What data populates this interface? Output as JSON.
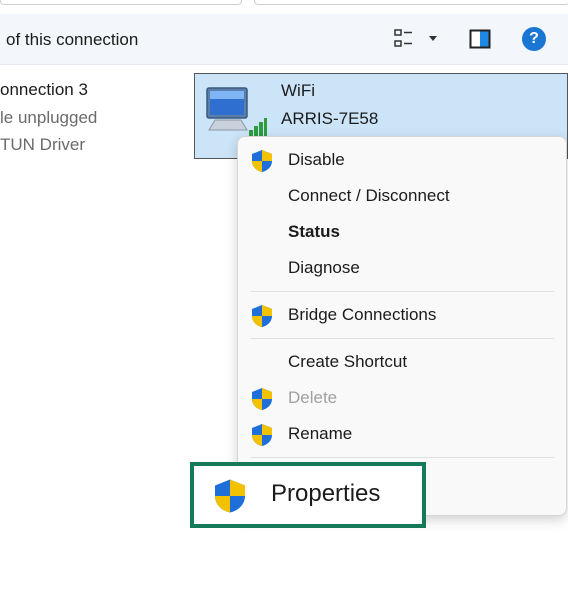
{
  "command_bar": {
    "description_text": "of this connection"
  },
  "left_adapter": {
    "name": "onnection 3",
    "status": "le unplugged",
    "driver": "TUN Driver"
  },
  "wifi_adapter": {
    "name": "WiFi",
    "ssid": "ARRIS-7E58"
  },
  "context_menu": {
    "items": [
      {
        "label": "Disable"
      },
      {
        "label": "Connect / Disconnect"
      },
      {
        "label": "Status"
      },
      {
        "label": "Diagnose"
      },
      {
        "label": "Bridge Connections"
      },
      {
        "label": "Create Shortcut"
      },
      {
        "label": "Delete"
      },
      {
        "label": "Rename"
      }
    ]
  },
  "callout": {
    "label": "Properties",
    "border_color": "#157a5a"
  },
  "colors": {
    "selection": "#cce4f7",
    "help_blue": "#1976d2",
    "disabled_text": "#a0a0a0"
  },
  "icons": [
    "view-options-icon",
    "preview-pane-icon",
    "help-icon",
    "network-computer-icon",
    "uac-shield-icon"
  ]
}
